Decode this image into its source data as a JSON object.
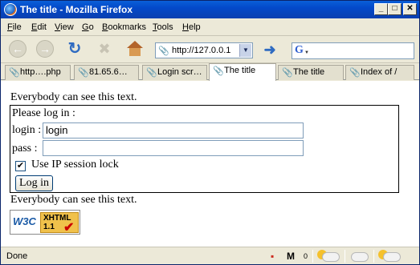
{
  "window": {
    "title": "The title - Mozilla Firefox",
    "min_symbol": "_",
    "max_symbol": "□",
    "close_symbol": "✕"
  },
  "menu": {
    "items": [
      {
        "prefix": "",
        "key": "F",
        "rest": "ile"
      },
      {
        "prefix": "",
        "key": "E",
        "rest": "dit"
      },
      {
        "prefix": "",
        "key": "V",
        "rest": "iew"
      },
      {
        "prefix": "",
        "key": "G",
        "rest": "o"
      },
      {
        "prefix": "",
        "key": "B",
        "rest": "ookmarks"
      },
      {
        "prefix": "",
        "key": "T",
        "rest": "ools"
      },
      {
        "prefix": "",
        "key": "H",
        "rest": "elp"
      }
    ]
  },
  "toolbar": {
    "back_glyph": "←",
    "forward_glyph": "→",
    "reload_glyph": "↻",
    "stop_glyph": "✖",
    "url": "http://127.0.0.1",
    "url_dropdown_glyph": "▼",
    "go_glyph": "➜",
    "search_engine_glyph": "G",
    "search_dropdown_glyph": "▼",
    "icons": {
      "back": "back-arrow-icon",
      "forward": "forward-arrow-icon",
      "reload": "reload-icon",
      "stop": "stop-icon",
      "home": "home-icon",
      "go": "go-icon",
      "search_engine": "google-icon"
    }
  },
  "tabs": [
    {
      "label": "http….php",
      "active": false
    },
    {
      "label": "81.65.6…",
      "active": false
    },
    {
      "label": "Login scr…",
      "active": false
    },
    {
      "label": "The title",
      "active": true
    },
    {
      "label": "The title",
      "active": false
    },
    {
      "label": "Index of /",
      "active": false
    }
  ],
  "page": {
    "intro_text": "Everybody can see this text.",
    "prompt": "Please log in :",
    "login_label": "login :",
    "login_value": "login",
    "pass_label": "pass :",
    "pass_value": "",
    "ip_lock_label": "Use IP session lock",
    "ip_lock_checked": true,
    "checkmark_glyph": "✔",
    "login_button": "Log in",
    "outro_text": "Everybody can see this text.",
    "badge": {
      "w3c": "W3C",
      "xhtml": "XHTML",
      "version": "1.1",
      "check_glyph": "✔"
    }
  },
  "status": {
    "text": "Done",
    "gmail_glyph": "M",
    "gmail_count": "0",
    "colors": {
      "gmail": "#cc2a1e"
    }
  }
}
